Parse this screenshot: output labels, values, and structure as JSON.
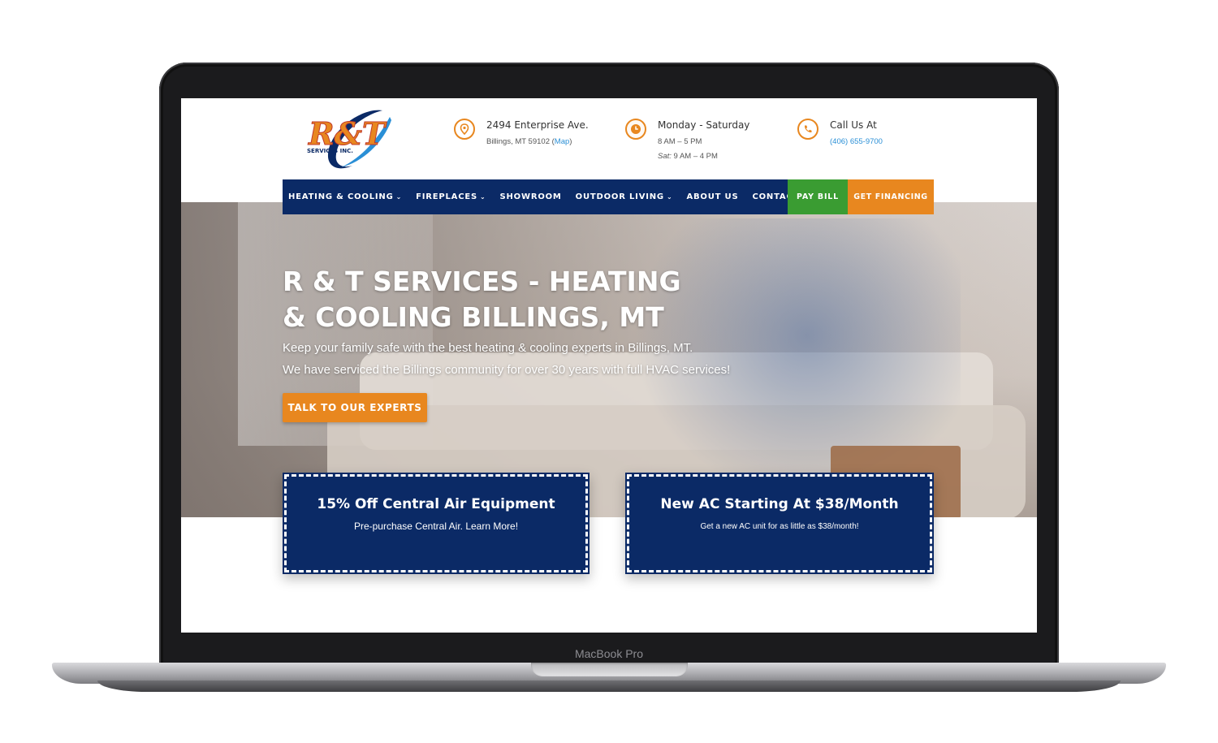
{
  "device": {
    "label": "MacBook Pro"
  },
  "header": {
    "logo_text": "R&T",
    "logo_subtext": "SERVICES INC.",
    "address": {
      "line1": "2494 Enterprise Ave.",
      "line2": "Billings, MT 59102 (",
      "map_link": "Map",
      "line2_end": ")"
    },
    "hours": {
      "line1": "Monday - Saturday",
      "line2": "8 AM – 5 PM",
      "sat_label": "Sat:",
      "line3": " 9 AM – 4 PM"
    },
    "phone": {
      "line1": "Call Us At",
      "number": "(406) 655-9700"
    }
  },
  "nav": {
    "items": [
      {
        "label": "HEATING & COOLING",
        "dropdown": true
      },
      {
        "label": "FIREPLACES",
        "dropdown": true
      },
      {
        "label": "SHOWROOM",
        "dropdown": false
      },
      {
        "label": "OUTDOOR LIVING",
        "dropdown": true
      },
      {
        "label": "ABOUT US",
        "dropdown": false
      },
      {
        "label": "CONTACT",
        "dropdown": false
      }
    ],
    "pay_bill": "PAY BILL",
    "financing": "GET FINANCING"
  },
  "hero": {
    "title": "R & T SERVICES - HEATING & COOLING BILLINGS, MT",
    "line1": "Keep your family safe with the best heating & cooling experts in Billings, MT.",
    "line2": "We have serviced the Billings community for over 30 years with full HVAC services!",
    "cta": "TALK TO OUR EXPERTS"
  },
  "promos": [
    {
      "title": "15% Off Central Air Equipment",
      "subtitle": "Pre-purchase Central Air. Learn More!"
    },
    {
      "title": "New AC Starting At $38/Month",
      "subtitle": "Get a new AC unit for as little as $38/month!"
    }
  ],
  "colors": {
    "navy": "#0b2a66",
    "orange": "#e8871f",
    "green": "#3a9c32",
    "link": "#2a8fd6"
  }
}
